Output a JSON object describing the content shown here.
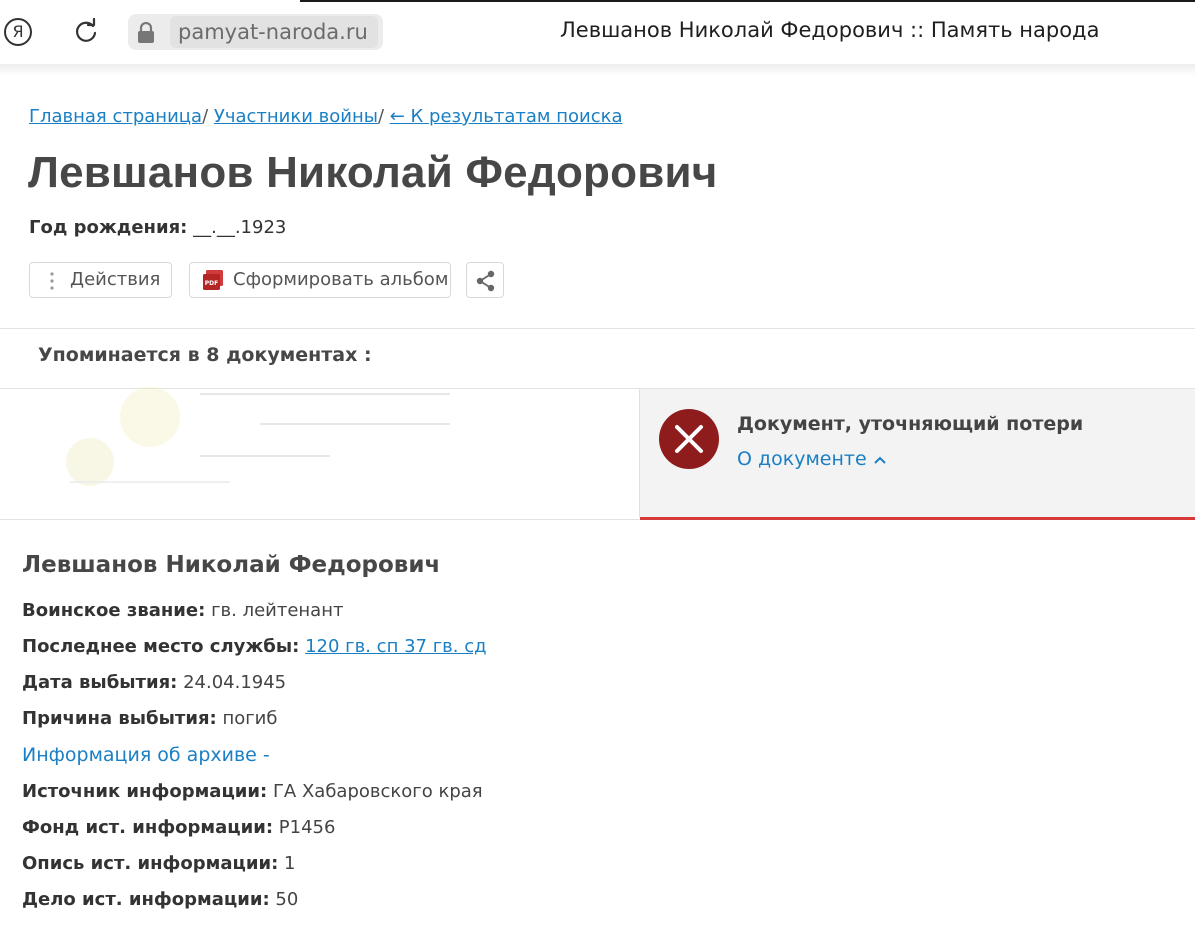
{
  "browser": {
    "yandex_glyph": "Я",
    "url": "pamyat-naroda.ru",
    "tab_title": "Левшанов Николай Федорович :: Память народа"
  },
  "breadcrumb": {
    "home": "Главная страница",
    "sep1": "/ ",
    "participants": "Участники войны",
    "sep2": "/ ",
    "back": "← К результатам поиска"
  },
  "person": {
    "name": "Левшанов Николай Федорович",
    "birth_label": "Год рождения:",
    "birth_value": "__.__.1923"
  },
  "actions": {
    "actions_label": "Действия",
    "album_label": "Сформировать альбом"
  },
  "mentions": "Упоминается в 8 документах :",
  "document": {
    "type": "Документ, уточняющий потери",
    "about": "О документе"
  },
  "record": {
    "name": "Левшанов Николай Федорович",
    "fields": [
      {
        "label": "Воинское звание:",
        "value": "гв. лейтенант"
      },
      {
        "label": "Последнее место службы:",
        "value": "120 гв. сп 37 гв. сд"
      },
      {
        "label": "Дата выбытия:",
        "value": "24.04.1945"
      },
      {
        "label": "Причина выбытия:",
        "value": "погиб"
      },
      {
        "label": "Источник информации:",
        "value": "ГА Хабаровского края"
      },
      {
        "label": "Фонд ист. информации:",
        "value": "Р1456"
      },
      {
        "label": "Опись ист. информации:",
        "value": "1"
      },
      {
        "label": "Дело ист. информации:",
        "value": "50"
      }
    ],
    "archive_link": "Информация об архиве -"
  },
  "colors": {
    "link": "#1a7fc4",
    "accent_red": "#d73a3a",
    "icon_dark_red": "#8f1c1c",
    "title_gray": "#474747"
  },
  "icons": [
    "yandex-icon",
    "reload-icon",
    "lock-icon",
    "dots-vertical-icon",
    "pdf-icon",
    "share-icon",
    "close-circle-icon",
    "chevron-up-icon"
  ]
}
